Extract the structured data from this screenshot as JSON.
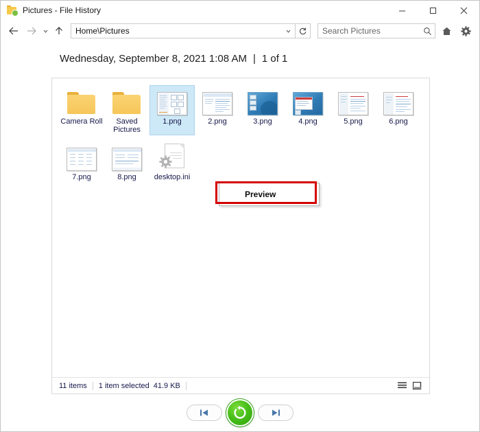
{
  "window": {
    "title": "Pictures - File History",
    "icon": "folder-history-icon",
    "buttons": {
      "minimize": "minimize-icon",
      "maximize": "maximize-icon",
      "close": "close-icon"
    }
  },
  "toolbar": {
    "back": "back-arrow-icon",
    "forward": "forward-arrow-icon",
    "recent": "chevron-down-icon",
    "up": "up-arrow-icon",
    "address_value": "Home\\Pictures",
    "address_dropdown": "chevron-down-icon",
    "refresh": "refresh-icon",
    "search_placeholder": "Search Pictures",
    "search_value": "",
    "search_icon": "search-icon",
    "home": "home-icon",
    "settings": "gear-icon"
  },
  "header": {
    "date": "Wednesday, September 8, 2021 1:08 AM",
    "separator": "|",
    "position": "1 of 1"
  },
  "files": [
    {
      "label": "Camera Roll",
      "type": "folder"
    },
    {
      "label": "Saved Pictures",
      "type": "folder"
    },
    {
      "label": "1.png",
      "type": "image-light",
      "selected": true
    },
    {
      "label": "2.png",
      "type": "image-doc"
    },
    {
      "label": "3.png",
      "type": "image-blue"
    },
    {
      "label": "4.png",
      "type": "image-blue-doc"
    },
    {
      "label": "5.png",
      "type": "image-doc"
    },
    {
      "label": "6.png",
      "type": "image-doc"
    },
    {
      "label": "7.png",
      "type": "image-table"
    },
    {
      "label": "8.png",
      "type": "image-form"
    },
    {
      "label": "desktop.ini",
      "type": "ini"
    }
  ],
  "context_menu": {
    "items": [
      {
        "label": "Preview",
        "highlighted": true
      }
    ],
    "annotation_color": "#d40000"
  },
  "status": {
    "item_count": "11 items",
    "selection": "1 item selected",
    "size": "41.9 KB",
    "view_details": "details-view-icon",
    "view_large": "large-icons-view-icon"
  },
  "controls": {
    "previous": "previous-version-icon",
    "restore": "restore-icon",
    "next": "next-version-icon",
    "restore_color": "#49c019"
  }
}
